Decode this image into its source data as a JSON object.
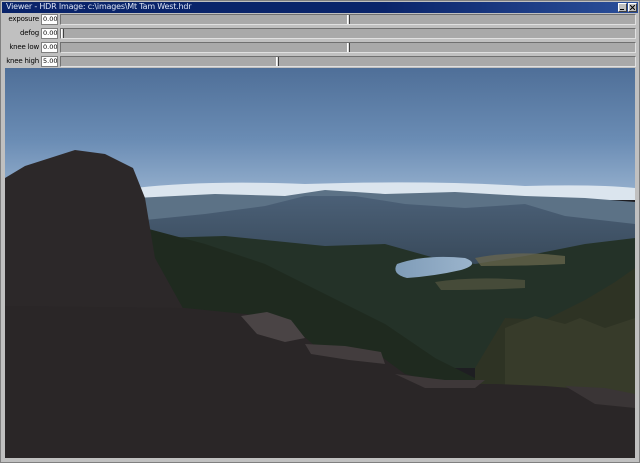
{
  "window": {
    "title": "Viewer - HDR Image: c:\\images\\Mt Tam West.hdr"
  },
  "controls": [
    {
      "label": "exposure",
      "value": "0.00",
      "position": 0.5
    },
    {
      "label": "defog",
      "value": "0.0000",
      "position": 0.0
    },
    {
      "label": "knee low",
      "value": "0.00",
      "position": 0.5
    },
    {
      "label": "knee high",
      "value": "5.00",
      "position": 0.377
    }
  ],
  "image": {
    "description_icon": "photo"
  }
}
